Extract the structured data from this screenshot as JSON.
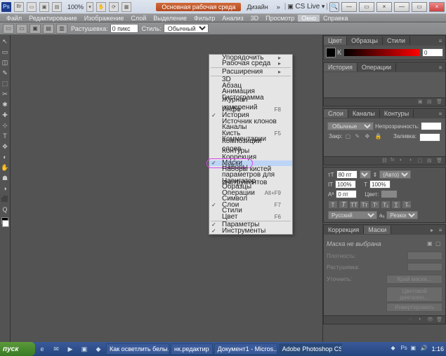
{
  "titlebar": {
    "ps": "Ps",
    "zoom": "100%",
    "workspace": "Основная рабочая среда",
    "design": "Дизайн",
    "cslive": "CS Live"
  },
  "menu": {
    "items": [
      "Файл",
      "Редактирование",
      "Изображение",
      "Слой",
      "Выделение",
      "Фильтр",
      "Анализ",
      "3D",
      "Просмотр",
      "Окно",
      "Справка"
    ],
    "activeIndex": 9
  },
  "options": {
    "feather_label": "Растушевка:",
    "feather_val": "0 пикс",
    "style_label": "Стиль:",
    "style_val": "Обычный"
  },
  "dropdown": [
    {
      "label": "Упорядочить",
      "arrow": true
    },
    {
      "label": "Рабочая среда",
      "arrow": true
    },
    {
      "sep": true
    },
    {
      "label": "Расширения",
      "arrow": true
    },
    {
      "sep": true
    },
    {
      "label": "3D"
    },
    {
      "label": "Абзац"
    },
    {
      "label": "Анимация"
    },
    {
      "label": "Гистограмма"
    },
    {
      "label": "Журнал измерений"
    },
    {
      "label": "Инфо",
      "key": "F8"
    },
    {
      "label": "История",
      "check": true
    },
    {
      "label": "Источник клонов"
    },
    {
      "label": "Каналы"
    },
    {
      "label": "Кисть",
      "key": "F5"
    },
    {
      "label": "Комментарии"
    },
    {
      "label": "Композиции слоев"
    },
    {
      "label": "Контуры"
    },
    {
      "label": "Коррекция"
    },
    {
      "label": "Маски",
      "check": true,
      "highlight": true,
      "ring": true
    },
    {
      "label": "Наборы кистей"
    },
    {
      "label": "Наборы параметров для инструментов"
    },
    {
      "label": "Навигатор"
    },
    {
      "label": "Образцы"
    },
    {
      "label": "Операции",
      "key": "Alt+F9"
    },
    {
      "label": "Символ"
    },
    {
      "label": "Слои",
      "check": true,
      "key": "F7"
    },
    {
      "label": "Стили"
    },
    {
      "label": "Цвет",
      "key": "F6"
    },
    {
      "sep": true
    },
    {
      "label": "Параметры",
      "check": true
    },
    {
      "label": "Инструменты",
      "check": true
    }
  ],
  "tools": [
    "↖",
    "▭",
    "◫",
    "✎",
    "⬚",
    "✂",
    "✱",
    "✚",
    "⊹",
    "T",
    "✥",
    "◐",
    "✋",
    "☗",
    "◑",
    "⬛",
    "Q"
  ],
  "panels": {
    "color": {
      "tabs": [
        "Цвет",
        "Образцы",
        "Стили"
      ],
      "value": "0"
    },
    "history": {
      "tabs": [
        "История",
        "Операции"
      ]
    },
    "layers": {
      "tabs": [
        "Слои",
        "Каналы",
        "Контуры"
      ],
      "mode": "Обычные",
      "opacity_label": "Непрозрачность:",
      "opacity": "",
      "fill_label": "Заливка:",
      "fill": ""
    },
    "character": {
      "size": "80 пт",
      "leading": "(Авто)",
      "tracking": "100%",
      "vscale": "100%",
      "baseline": "0 пт",
      "color_label": "Цвет:",
      "lang": "Русский",
      "aa": "Резкое"
    },
    "masks": {
      "tabs": [
        "Коррекция",
        "Маски"
      ],
      "message": "Маска не выбрана",
      "density_label": "Плотность:",
      "feather_label": "Растушевка:",
      "refine_label": "Уточнить:",
      "btn1": "Край маски...",
      "btn2": "Цветовой диапазон...",
      "btn3": "Инвертировать"
    }
  },
  "taskbar": {
    "start": "пуск",
    "items": [
      "Как осветлить белы...",
      "нк.редактир",
      "Документ1 - Micros...",
      "Adobe Photoshop CS..."
    ],
    "time": "1:16"
  }
}
